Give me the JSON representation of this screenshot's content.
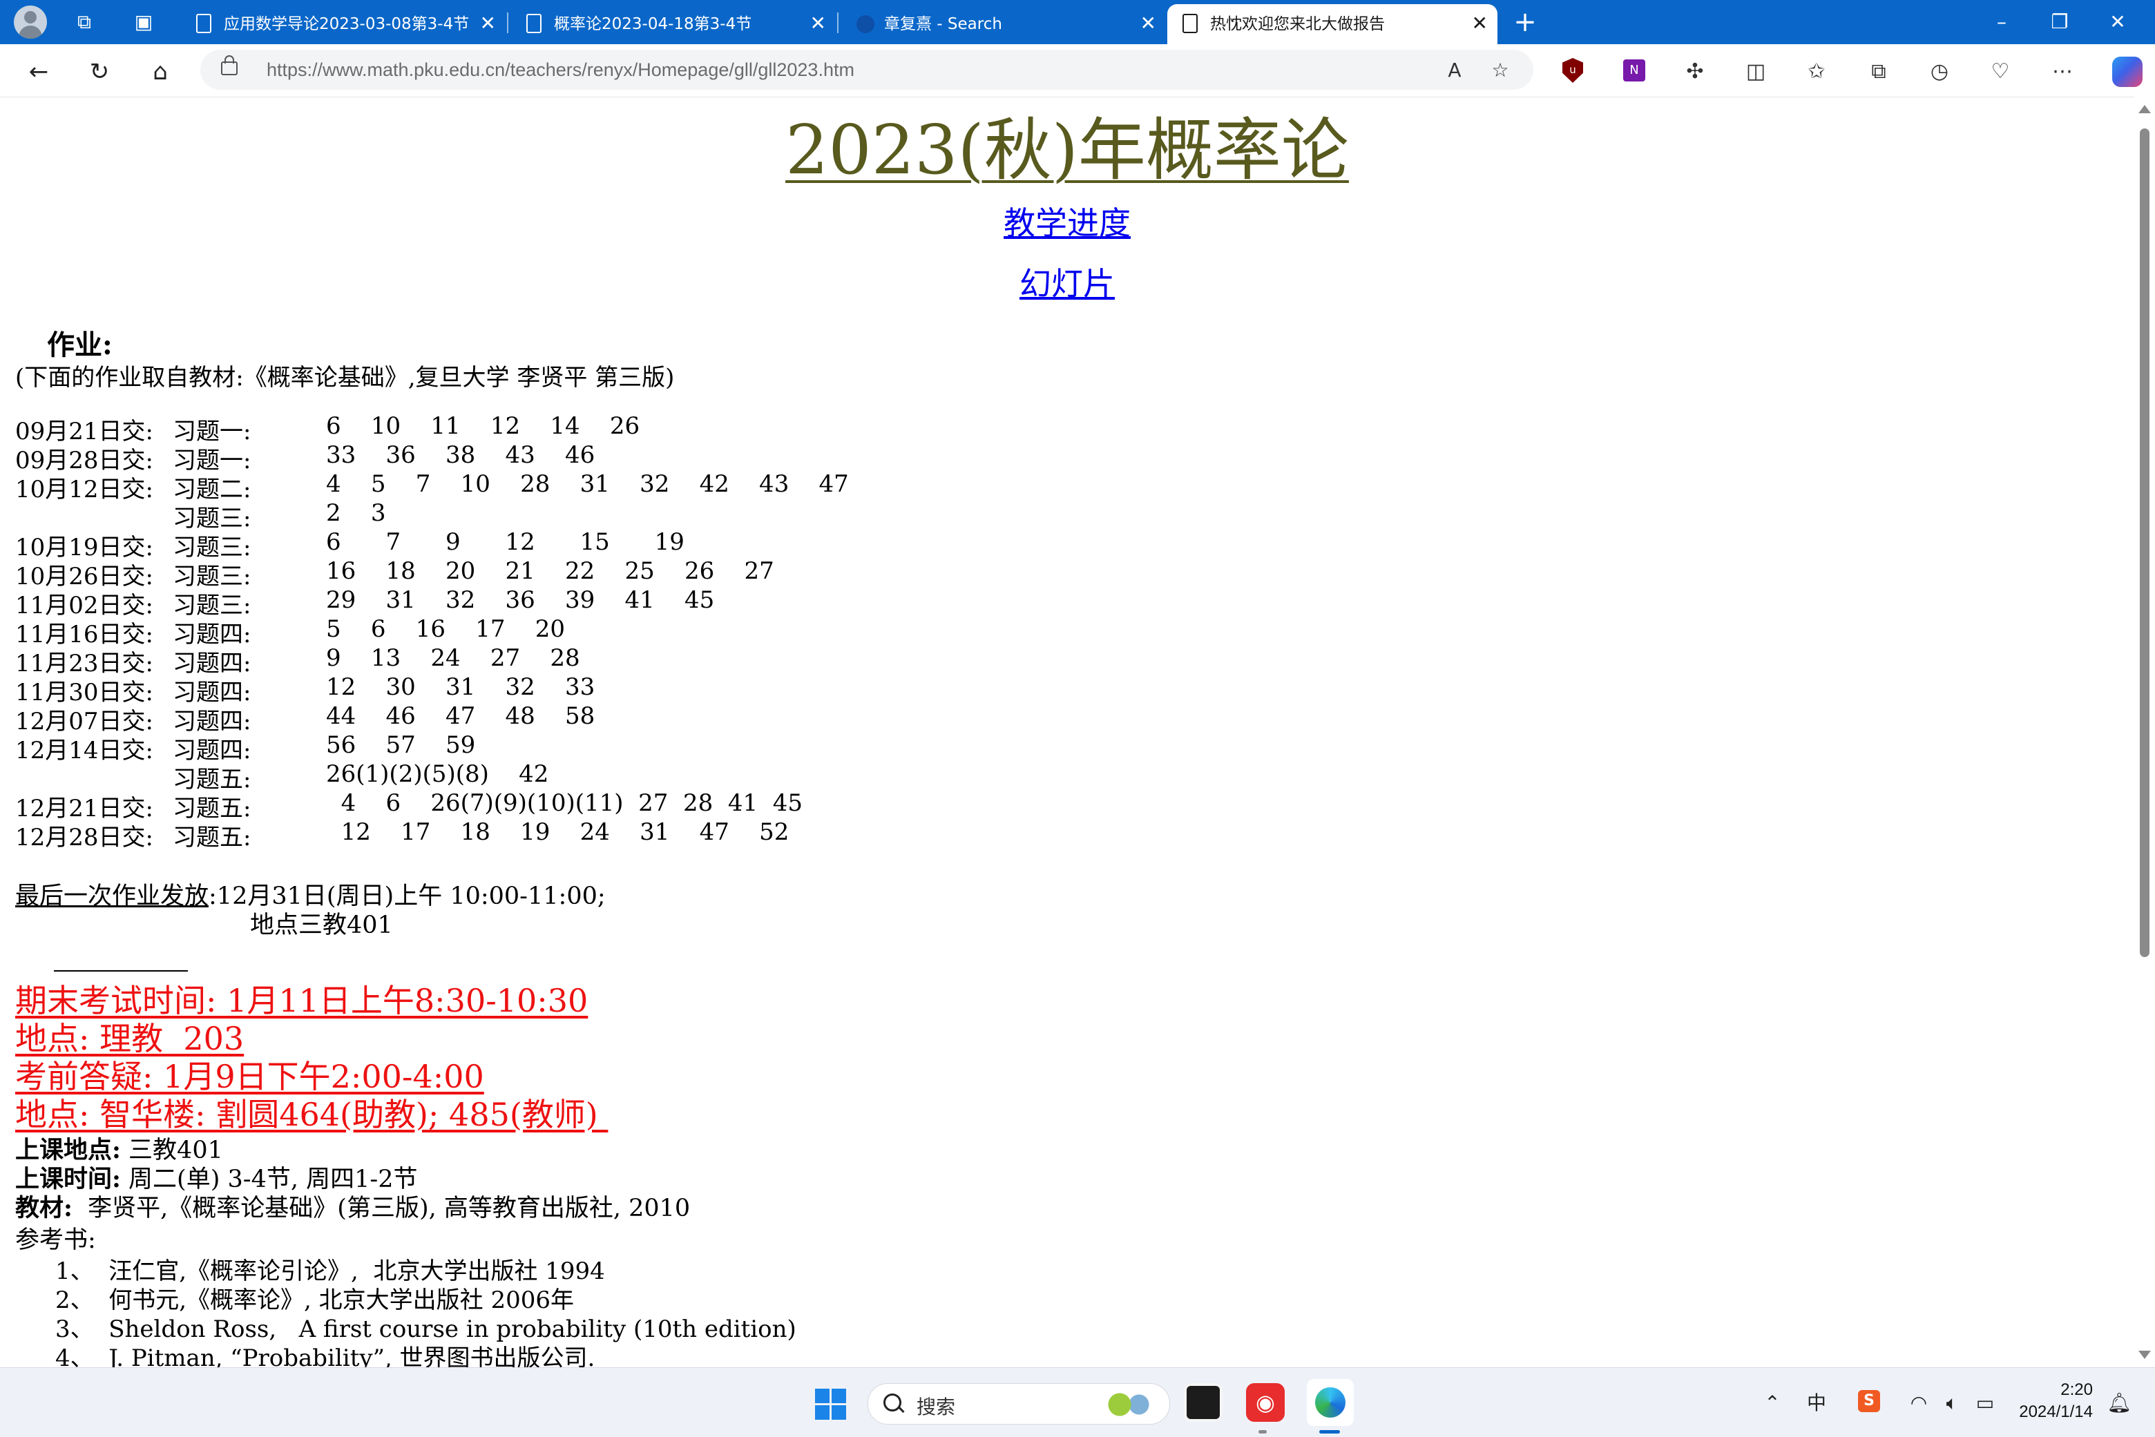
{
  "browser": {
    "tabs": [
      {
        "title": "应用数学导论2023-03-08第3-4节",
        "active": false
      },
      {
        "title": "概率论2023-04-18第3-4节",
        "active": false
      },
      {
        "title": "章复熹 - Search",
        "active": false
      },
      {
        "title": "热忱欢迎您来北大做报告",
        "active": true
      }
    ],
    "new_tab_label": "+",
    "window_controls": {
      "minimize": "–",
      "restore": "❐",
      "close": "✕"
    },
    "url": {
      "domain": "https://www.math.pku.edu.cn",
      "path": "/teachers/renyx/Homepage/gll/gll2023.htm"
    },
    "extension_onenote_label": "N"
  },
  "page": {
    "title": "2023(秋)年概率论",
    "links": {
      "progress": "教学进度",
      "slides": "幻灯片"
    },
    "homework_heading": "作业:",
    "homework_note": "(下面的作业取自教材:《概率论基础》,复旦大学 李贤平 第三版)",
    "homework": [
      {
        "date": "09月21日交:",
        "chapter": "习题一:",
        "problems": "6    10    11    12    14    26"
      },
      {
        "date": "09月28日交:",
        "chapter": "习题一:",
        "problems": "33    36    38    43    46"
      },
      {
        "date": "10月12日交:",
        "chapter": "习题二:",
        "problems": "4    5    7    10    28    31    32    42    43    47"
      },
      {
        "date": "",
        "chapter": "习题三:",
        "problems": "2    3"
      },
      {
        "date": "10月19日交:",
        "chapter": "习题三:",
        "problems": "6      7      9      12      15      19"
      },
      {
        "date": "10月26日交:",
        "chapter": "习题三:",
        "problems": "16    18    20    21    22    25    26    27"
      },
      {
        "date": "11月02日交:",
        "chapter": "习题三:",
        "problems": "29    31    32    36    39    41    45"
      },
      {
        "date": "11月16日交:",
        "chapter": "习题四:",
        "problems": "5    6    16    17    20"
      },
      {
        "date": "11月23日交:",
        "chapter": "习题四:",
        "problems": "9    13    24    27    28"
      },
      {
        "date": "11月30日交:",
        "chapter": "习题四:",
        "problems": "12    30    31    32    33"
      },
      {
        "date": "12月07日交:",
        "chapter": "习题四:",
        "problems": "44    46    47    48    58"
      },
      {
        "date": "12月14日交:",
        "chapter": "习题四:",
        "problems": "56    57    59"
      },
      {
        "date": "",
        "chapter": "习题五:",
        "problems": "26(1)(2)(5)(8)    42"
      },
      {
        "date": "12月21日交:",
        "chapter": "习题五:",
        "problems": "  4    6    26(7)(9)(10)(11)  27  28  41  45"
      },
      {
        "date": "12月28日交:",
        "chapter": "习题五:",
        "problems": "  12    17    18    19    24    31    47    52"
      }
    ],
    "last_homework_label": "最后一次作业发放",
    "last_homework_time": ":12月31日(周日)上午 10:00-11:00;",
    "last_homework_place": "地点三教401",
    "exam": {
      "time": "期末考试时间: 1月11日上午8:30-10:30",
      "place": "地点: 理教  203",
      "qa_time": "考前答疑: 1月9日下午2:00-4:00",
      "qa_place": "地点: 智华楼: 割圆464(助教); 485(教师) "
    },
    "class_place_label": "上课地点:",
    "class_place": " 三教401",
    "class_time_label": "上课时间:",
    "class_time": " 周二(单) 3-4节, 周四1-2节",
    "textbook_label": "教材:",
    "textbook": "  李贤平,《概率论基础》(第三版), 高等教育出版社, 2010",
    "refs_label": "参考书:",
    "refs": [
      "1、  汪仁官,《概率论引论》,  北京大学出版社 1994",
      "2、  何书元,《概率论》, 北京大学出版社 2006年",
      "3、  Sheldon Ross,   A first course in probability (10th edition)",
      "4、  J. Pitman, “Probability”, 世界图书出版公司."
    ]
  },
  "taskbar": {
    "search_placeholder": "搜索",
    "net_app_label": "◉",
    "ime": "中",
    "sogou": "S",
    "time": "2:20",
    "date": "2024/1/14"
  },
  "colors": {
    "titlebar": "#0a67c9",
    "link": "#0000ee",
    "exam_red": "#ee1111",
    "title_olive": "#585a1e"
  }
}
